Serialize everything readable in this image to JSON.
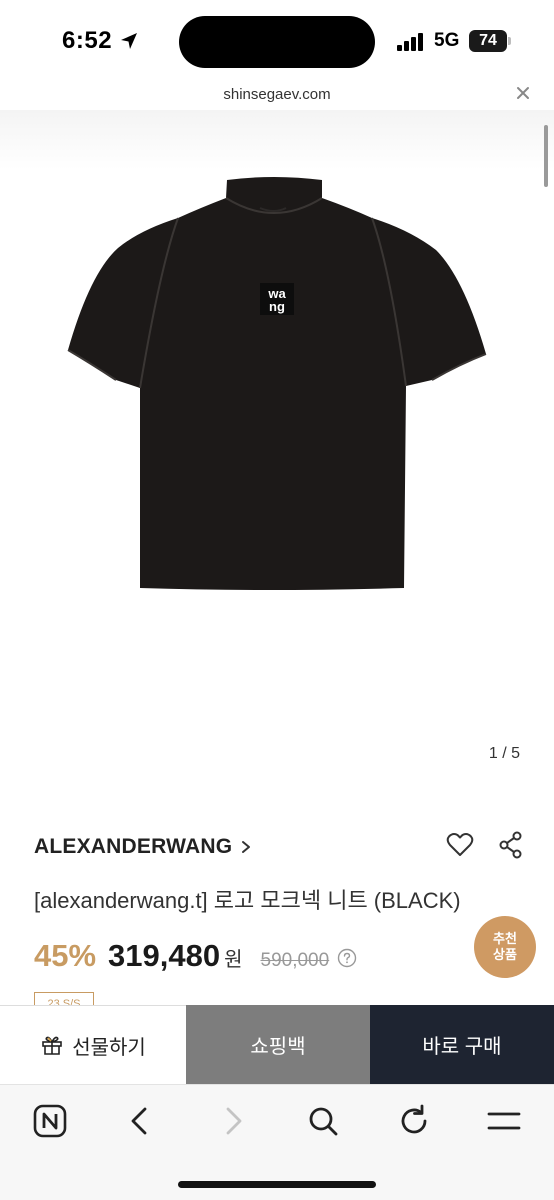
{
  "status_bar": {
    "time": "6:52",
    "network": "5G",
    "battery": "74"
  },
  "browser": {
    "url": "shinsegaev.com"
  },
  "gallery": {
    "pager": "1 / 5",
    "logo_text_top": "wa",
    "logo_text_bottom": "ng"
  },
  "product": {
    "brand": "ALEXANDERWANG",
    "title": "[alexanderwang.t] 로고 모크넥 니트 (BLACK)",
    "discount": "45%",
    "price": "319,480",
    "currency": "원",
    "original_price": "590,000",
    "season_tag": "23 S/S"
  },
  "recommend_badge": {
    "line1": "추천",
    "line2": "상품"
  },
  "cta": {
    "gift_label": "선물하기",
    "cart_label": "쇼핑백",
    "buy_label": "바로 구매"
  },
  "colors": {
    "accent": "#c89b62",
    "badge": "#cf9a63",
    "cart_bg": "#7d7d7d",
    "buy_bg": "#1e2431"
  },
  "icons": {
    "location": "location-arrow-icon",
    "signal": "cellular-signal-icon",
    "close": "close-icon",
    "brand_chevron": "chevron-right-icon",
    "wishlist": "heart-icon",
    "share": "share-icon",
    "price_info": "question-circle-icon",
    "gift": "gift-icon",
    "toolbar": [
      "naver-home-icon",
      "back-arrow-icon",
      "forward-arrow-icon",
      "search-icon",
      "refresh-icon",
      "menu-icon"
    ]
  }
}
